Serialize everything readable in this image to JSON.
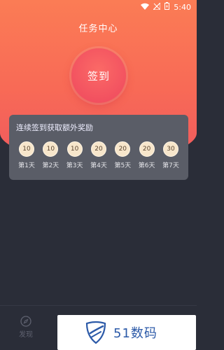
{
  "status_bar": {
    "time": "5:40"
  },
  "header": {
    "title": "任务中心"
  },
  "checkin": {
    "button_label": "签到"
  },
  "reward_card": {
    "title": "连续签到获取额外奖励",
    "days": [
      {
        "points": "10",
        "label": "第1天"
      },
      {
        "points": "10",
        "label": "第2天"
      },
      {
        "points": "10",
        "label": "第3天"
      },
      {
        "points": "20",
        "label": "第4天"
      },
      {
        "points": "20",
        "label": "第5天"
      },
      {
        "points": "20",
        "label": "第6天"
      },
      {
        "points": "30",
        "label": "第7天"
      }
    ]
  },
  "bottom_nav": {
    "discover_label": "发现"
  },
  "watermark": {
    "text": "51数码"
  },
  "colors": {
    "hero_top": "#fb7c55",
    "hero_bottom": "#ef5a5e",
    "background": "#2a2d38",
    "card": "#5a5d67",
    "coin": "#f7e6cb"
  },
  "icons": [
    "wifi-icon",
    "signal-icon",
    "battery-icon",
    "compass-icon",
    "shield-logo-icon"
  ]
}
